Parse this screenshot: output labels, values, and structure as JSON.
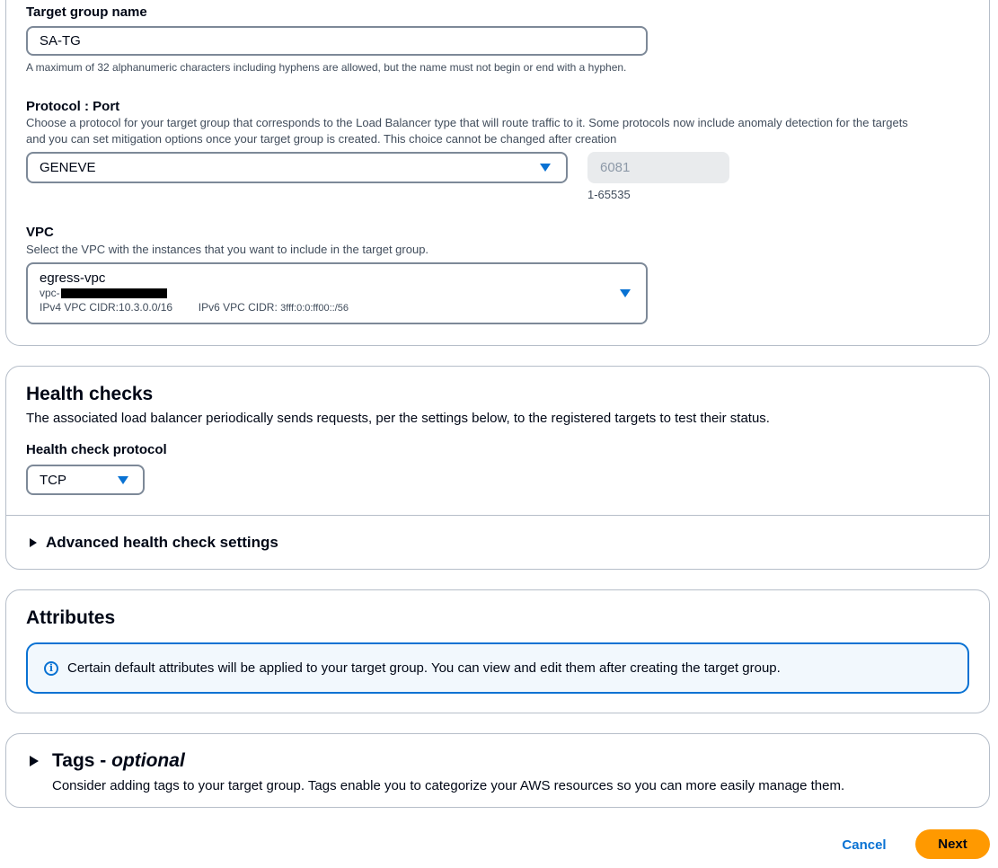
{
  "target_group_name": {
    "label": "Target group name",
    "value": "SA-TG",
    "hint": "A maximum of 32 alphanumeric characters including hyphens are allowed, but the name must not begin or end with a hyphen."
  },
  "protocol_port": {
    "label": "Protocol : Port",
    "desc_line1": "Choose a protocol for your target group that corresponds to the Load Balancer type that will route traffic to it. Some protocols now include anomaly detection for the targets",
    "desc_line2": "and you can set mitigation options once your target group is created. This choice cannot be changed after creation",
    "protocol_value": "GENEVE",
    "port_value": "6081",
    "port_range": "1-65535"
  },
  "vpc": {
    "label": "VPC",
    "desc": "Select the VPC with the instances that you want to include in the target group.",
    "name": "egress-vpc",
    "id_prefix": "vpc-",
    "ipv4": "IPv4 VPC CIDR:10.3.0.0/16",
    "ipv6_label": "IPv6 VPC CIDR:",
    "ipv6_value": "3fff:0:0:ff00::/56"
  },
  "health_checks": {
    "title": "Health checks",
    "desc": "The associated load balancer periodically sends requests, per the settings below, to the registered targets to test their status.",
    "protocol_label": "Health check protocol",
    "protocol_value": "TCP",
    "advanced_label": "Advanced health check settings"
  },
  "attributes": {
    "title": "Attributes",
    "info": "Certain default attributes will be applied to your target group. You can view and edit them after creating the target group."
  },
  "tags": {
    "title": "Tags - ",
    "title_optional": "optional",
    "desc": "Consider adding tags to your target group. Tags enable you to categorize your AWS resources so you can more easily manage them."
  },
  "footer": {
    "cancel": "Cancel",
    "next": "Next"
  },
  "colors": {
    "accent": "#0972d3",
    "primary_button": "#ff9900",
    "border": "#b6bec9"
  }
}
